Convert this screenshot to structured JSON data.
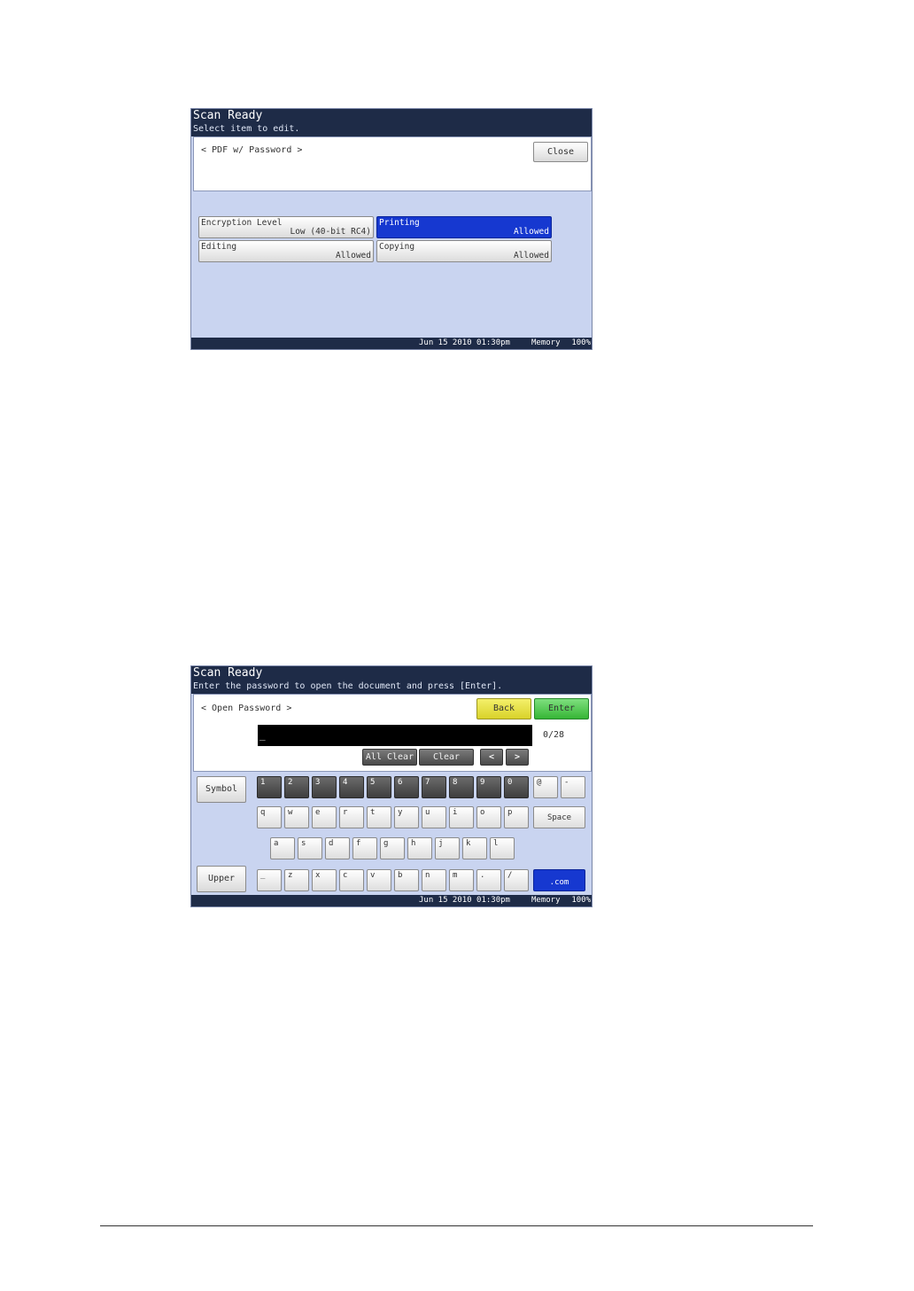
{
  "screen1": {
    "title": "Scan Ready",
    "subtitle": "Select item to edit.",
    "breadcrumb": "< PDF w/ Password >",
    "close_label": "Close",
    "settings": [
      {
        "label": "Encryption Level",
        "value": "Low (40-bit RC4)",
        "selected": false
      },
      {
        "label": "Printing",
        "value": "Allowed",
        "selected": true
      },
      {
        "label": "Editing",
        "value": "Allowed",
        "selected": false
      },
      {
        "label": "Copying",
        "value": "Allowed",
        "selected": false
      }
    ],
    "status": {
      "datetime": "Jun 15 2010 01:30pm",
      "memory_label": "Memory",
      "memory_value": "100%"
    }
  },
  "screen2": {
    "title": "Scan Ready",
    "subtitle": "Enter the password to open the document and press [Enter].",
    "breadcrumb": "< Open Password >",
    "back_label": "Back",
    "enter_label": "Enter",
    "input_value": "_",
    "char_count": "0/28",
    "all_clear_label": "All Clear",
    "clear_label": "Clear",
    "left_arrow": "<",
    "right_arrow": ">",
    "symbol_label": "Symbol",
    "upper_label": "Upper",
    "keys_row1": [
      "1",
      "2",
      "3",
      "4",
      "5",
      "6",
      "7",
      "8",
      "9",
      "0",
      "@",
      "-"
    ],
    "keys_row2": [
      "q",
      "w",
      "e",
      "r",
      "t",
      "y",
      "u",
      "i",
      "o",
      "p"
    ],
    "space_label": "Space",
    "keys_row3": [
      "a",
      "s",
      "d",
      "f",
      "g",
      "h",
      "j",
      "k",
      "l"
    ],
    "keys_row4": [
      "_",
      "z",
      "x",
      "c",
      "v",
      "b",
      "n",
      "m",
      ".",
      "/"
    ],
    "dotcom_label": ".com",
    "status": {
      "datetime": "Jun 15 2010 01:30pm",
      "memory_label": "Memory",
      "memory_value": "100%"
    }
  },
  "colors": {
    "titlebar": "#1e2b47",
    "selected": "#1638d0",
    "back_button": "#e8e23c",
    "enter_button": "#4fc64f",
    "screen_bg": "#c9d4f0"
  }
}
